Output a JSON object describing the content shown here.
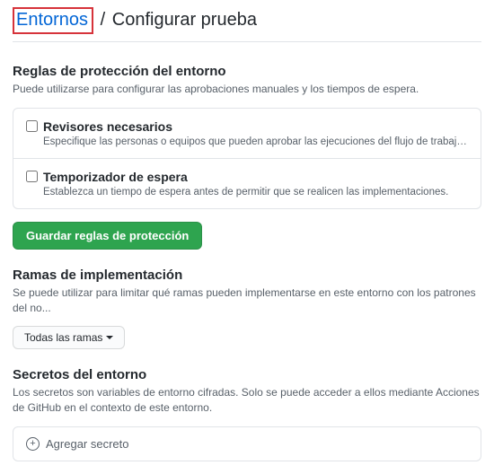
{
  "breadcrumb": {
    "root": "Entornos",
    "separator": "/",
    "current": "Configurar prueba"
  },
  "protection": {
    "title": "Reglas de protección del entorno",
    "desc": "Puede utilizarse para configurar las aprobaciones manuales y los tiempos de espera.",
    "rules": [
      {
        "label": "Revisores necesarios",
        "desc": "Especifique las personas o equipos que pueden aprobar las ejecuciones del flujo de trabajo cuando acceden a es...",
        "checked": false
      },
      {
        "label": "Temporizador de espera",
        "desc": "Establezca un tiempo de espera antes de permitir que se realicen las implementaciones.",
        "checked": false
      }
    ],
    "save_button": "Guardar reglas de protección"
  },
  "branches": {
    "title": "Ramas de implementación",
    "desc": "Se puede utilizar para limitar qué ramas pueden implementarse en este entorno con los patrones del no...",
    "dropdown_label": "Todas las ramas"
  },
  "secrets": {
    "title": "Secretos del entorno",
    "desc": "Los secretos son variables de entorno cifradas. Solo se puede acceder a ellos mediante Acciones de GitHub en el contexto de este entorno.",
    "add_label": "Agregar secreto"
  }
}
